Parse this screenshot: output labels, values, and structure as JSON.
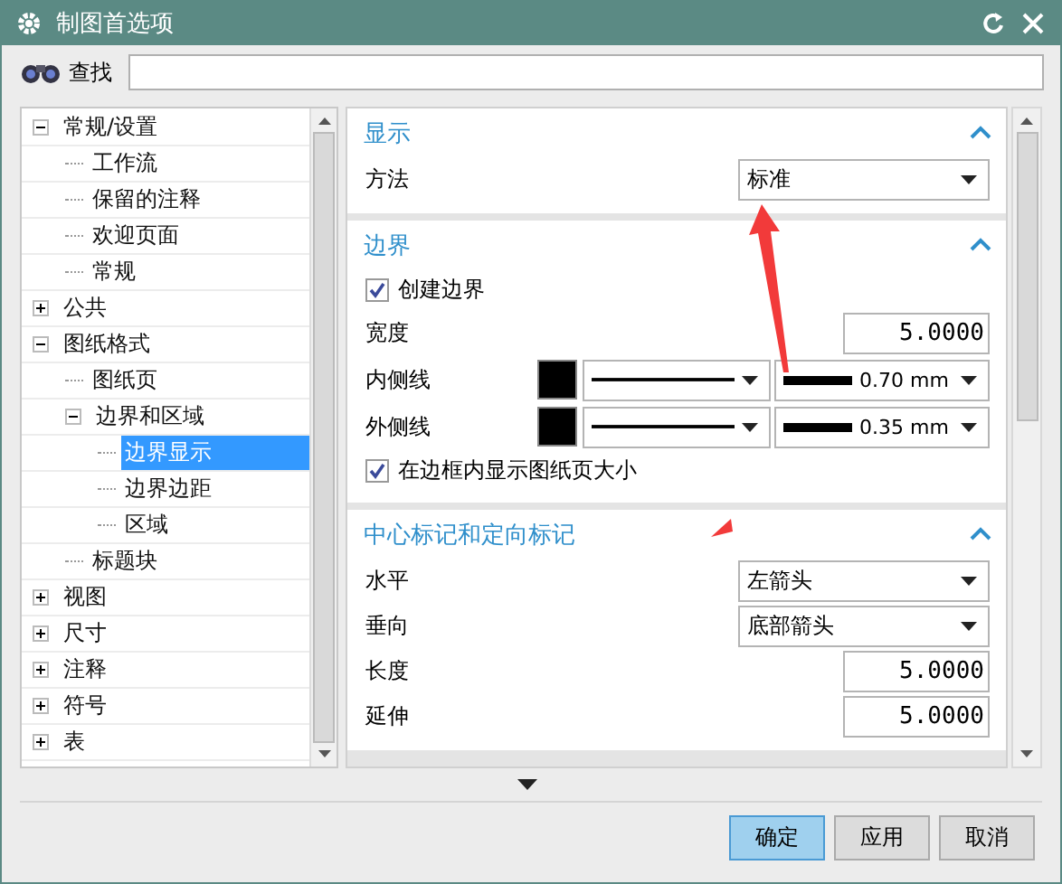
{
  "window": {
    "title": "制图首选项"
  },
  "search": {
    "label": "查找"
  },
  "tree": [
    {
      "label": "常规/设置",
      "expanded": true,
      "selected": false,
      "children": [
        {
          "label": "工作流",
          "selected": false
        },
        {
          "label": "保留的注释",
          "selected": false
        },
        {
          "label": "欢迎页面",
          "selected": false
        },
        {
          "label": "常规",
          "selected": false
        }
      ]
    },
    {
      "label": "公共",
      "expanded": false,
      "selected": false
    },
    {
      "label": "图纸格式",
      "expanded": true,
      "selected": false,
      "children": [
        {
          "label": "图纸页",
          "selected": false
        },
        {
          "label": "边界和区域",
          "expanded": true,
          "selected": false,
          "children": [
            {
              "label": "边界显示",
              "selected": true
            },
            {
              "label": "边界边距",
              "selected": false
            },
            {
              "label": "区域",
              "selected": false
            }
          ]
        },
        {
          "label": "标题块",
          "selected": false
        }
      ]
    },
    {
      "label": "视图",
      "expanded": false,
      "selected": false
    },
    {
      "label": "尺寸",
      "expanded": false,
      "selected": false
    },
    {
      "label": "注释",
      "expanded": false,
      "selected": false
    },
    {
      "label": "符号",
      "expanded": false,
      "selected": false
    },
    {
      "label": "表",
      "expanded": false,
      "selected": false
    }
  ],
  "sections": [
    {
      "title": "显示",
      "expanded": true,
      "rows": [
        {
          "kind": "dropdown",
          "label": "方法",
          "value": "标准"
        }
      ]
    },
    {
      "title": "边界",
      "expanded": true,
      "rows": [
        {
          "kind": "checkbox",
          "label": "创建边界",
          "checked": true
        },
        {
          "kind": "number",
          "label": "宽度",
          "value": "5.0000"
        },
        {
          "kind": "line",
          "label": "内侧线",
          "color": "#000000",
          "width": "0.70 mm"
        },
        {
          "kind": "line",
          "label": "外侧线",
          "color": "#000000",
          "width": "0.35 mm"
        },
        {
          "kind": "checkbox",
          "label": "在边框内显示图纸页大小",
          "checked": true
        }
      ]
    },
    {
      "title": "中心标记和定向标记",
      "expanded": true,
      "rows": [
        {
          "kind": "dropdown",
          "label": "水平",
          "value": "左箭头"
        },
        {
          "kind": "dropdown",
          "label": "垂向",
          "value": "底部箭头"
        },
        {
          "kind": "number",
          "label": "长度",
          "value": "5.0000"
        },
        {
          "kind": "number",
          "label": "延伸",
          "value": "5.0000"
        }
      ]
    }
  ],
  "buttons": [
    {
      "label": "确定",
      "default": true
    },
    {
      "label": "应用",
      "default": false
    },
    {
      "label": "取消",
      "default": false
    }
  ],
  "annotations": [
    {
      "kind": "arrow"
    },
    {
      "kind": "arrowhead"
    }
  ]
}
